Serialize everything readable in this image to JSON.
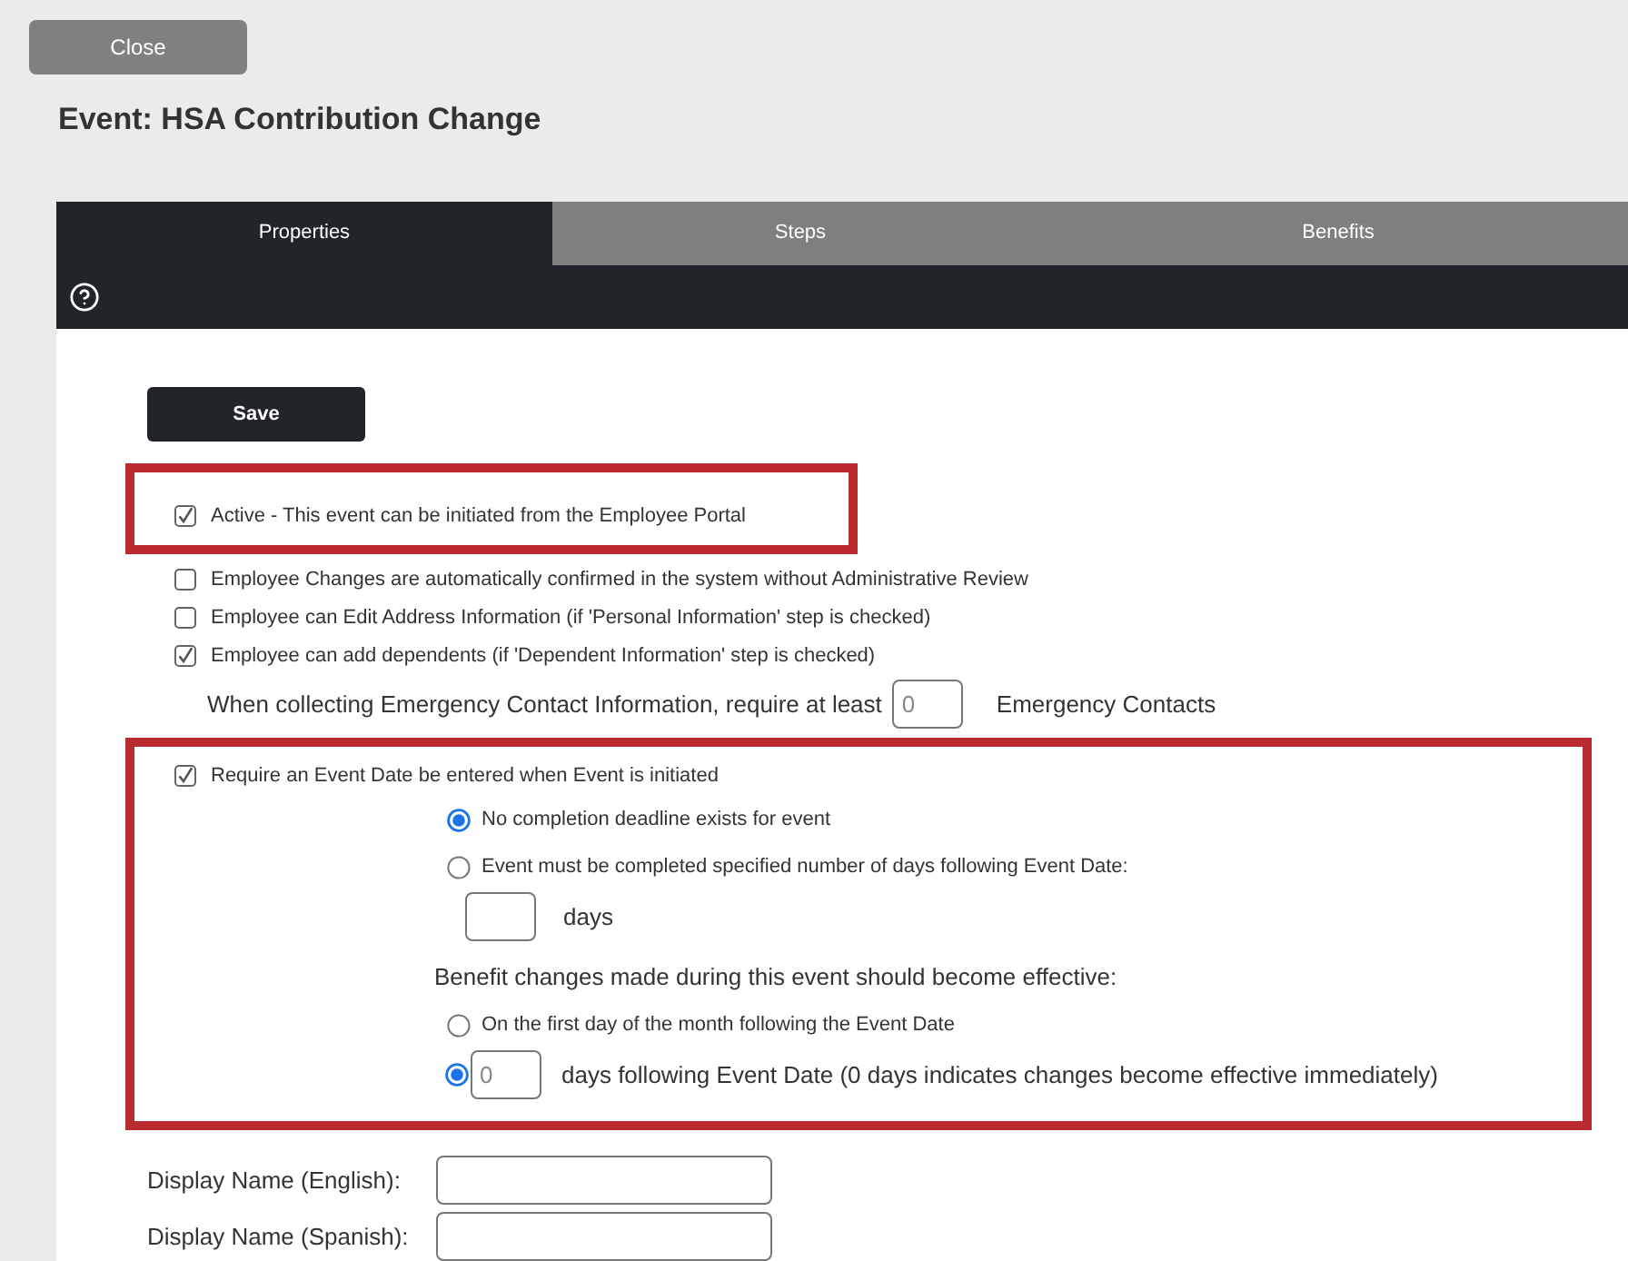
{
  "header": {
    "close_button": "Close",
    "title": "Event: HSA Contribution Change"
  },
  "tabs": [
    {
      "label": "Properties",
      "selected": true
    },
    {
      "label": "Steps",
      "selected": false
    },
    {
      "label": "Benefits",
      "selected": false
    }
  ],
  "save_button": "Save",
  "sections": [
    {
      "highlighted": true,
      "items": [
        {
          "kind": "checkbox",
          "label": "Active - This event can be initiated from the Employee Portal",
          "checked": true
        }
      ]
    },
    {
      "highlighted": false,
      "items": [
        {
          "kind": "checkbox",
          "label": "Employee Changes are automatically confirmed in the system without Administrative Review",
          "checked": false
        },
        {
          "kind": "checkbox",
          "label": "Employee can Edit Address Information (if 'Personal Information' step is checked)",
          "checked": false
        },
        {
          "kind": "checkbox",
          "label": "Employee can add dependents (if 'Dependent Information' step is checked)",
          "checked": true
        },
        {
          "kind": "count_field",
          "prefix": "When collecting Emergency Contact Information, require at least",
          "placeholder": "0",
          "suffix": "Emergency Contacts"
        }
      ]
    },
    {
      "highlighted": true,
      "items": [
        {
          "kind": "checkbox",
          "label": "Require an Event Date be entered when Event is initiated",
          "checked": true
        },
        {
          "kind": "radio",
          "label": "No completion deadline exists for event",
          "selected": true
        },
        {
          "kind": "radio",
          "label": "Event must be completed specified number of days following Event Date:",
          "selected": false
        },
        {
          "kind": "days_field",
          "suffix": "days"
        },
        {
          "kind": "heading",
          "text": "Benefit changes made during this event should become effective:"
        },
        {
          "kind": "radio",
          "label": "On the first day of the month following the Event Date",
          "selected": false
        },
        {
          "kind": "radio_field",
          "placeholder": "0",
          "suffix": "days following Event Date (0 days indicates changes become effective immediately)",
          "selected": true
        }
      ]
    }
  ],
  "display_names": [
    {
      "label": "Display Name (English):"
    },
    {
      "label": "Display Name (Spanish):"
    }
  ]
}
